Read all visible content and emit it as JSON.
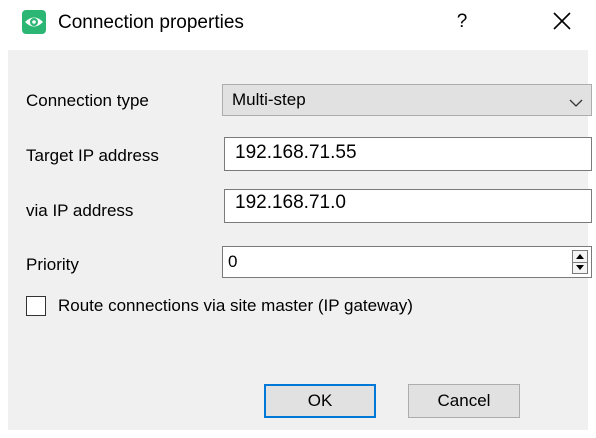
{
  "window": {
    "title": "Connection properties",
    "help_label": "?",
    "icon": "eye-icon",
    "accent_color": "#2bb673",
    "focus_color": "#0078d7"
  },
  "form": {
    "connection_type": {
      "label": "Connection type",
      "value": "Multi-step"
    },
    "target_ip": {
      "label": "Target IP address",
      "value": "192.168.71.55"
    },
    "via_ip": {
      "label": "via IP address",
      "value": "192.168.71.0"
    },
    "priority": {
      "label": "Priority",
      "value": "0"
    },
    "route_via_master": {
      "label": "Route connections via site master (IP gateway)",
      "checked": false
    }
  },
  "buttons": {
    "ok_label": "OK",
    "cancel_label": "Cancel"
  }
}
